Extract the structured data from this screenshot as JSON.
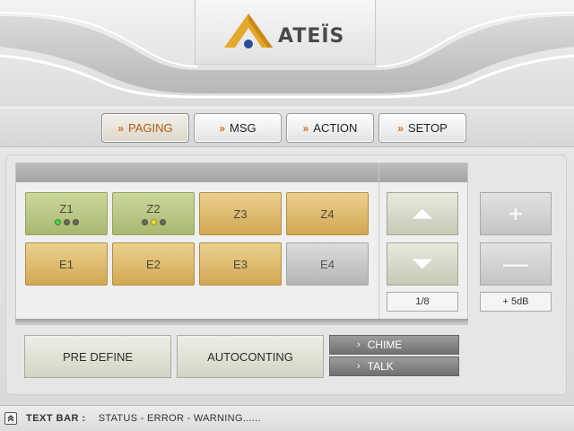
{
  "header": {
    "brand": "ATEÏS"
  },
  "tabs": [
    {
      "label": "PAGING",
      "chevron": "»",
      "active": true
    },
    {
      "label": "MSG",
      "chevron": "»",
      "active": false
    },
    {
      "label": "ACTION",
      "chevron": "»",
      "active": false
    },
    {
      "label": "SETOP",
      "chevron": "»",
      "active": false
    }
  ],
  "zones": [
    {
      "label": "Z1",
      "state": "green",
      "indicators": [
        "green",
        "off",
        "off"
      ]
    },
    {
      "label": "Z2",
      "state": "green",
      "indicators": [
        "off",
        "yellow",
        "off"
      ]
    },
    {
      "label": "Z3",
      "state": "orange"
    },
    {
      "label": "Z4",
      "state": "orange"
    },
    {
      "label": "E1",
      "state": "orange"
    },
    {
      "label": "E2",
      "state": "orange"
    },
    {
      "label": "E3",
      "state": "orange"
    },
    {
      "label": "E4",
      "state": "grey"
    }
  ],
  "navigation": {
    "page_indicator": "1/8",
    "up_icon": "triangle-up-icon",
    "down_icon": "triangle-down-icon"
  },
  "volume": {
    "plus_symbol": "+",
    "minus_symbol": "—",
    "level": "+ 5dB"
  },
  "actions": {
    "pre_define": "PRE DEFINE",
    "autoconting": "AUTOCONTING",
    "chime": "CHIME",
    "talk": "TALK",
    "chevron": "›"
  },
  "status_bar": {
    "icon": "double-chevron-up-icon",
    "label": "TEXT BAR :",
    "text": "STATUS - ERROR - WARNING......"
  },
  "colors": {
    "accent": "#d26d18",
    "zone_green": "#b8c67f",
    "zone_orange": "#deb86a",
    "zone_grey": "#c6c6c6",
    "indicator_green": "#4bd43e",
    "indicator_yellow": "#f4d43c"
  }
}
